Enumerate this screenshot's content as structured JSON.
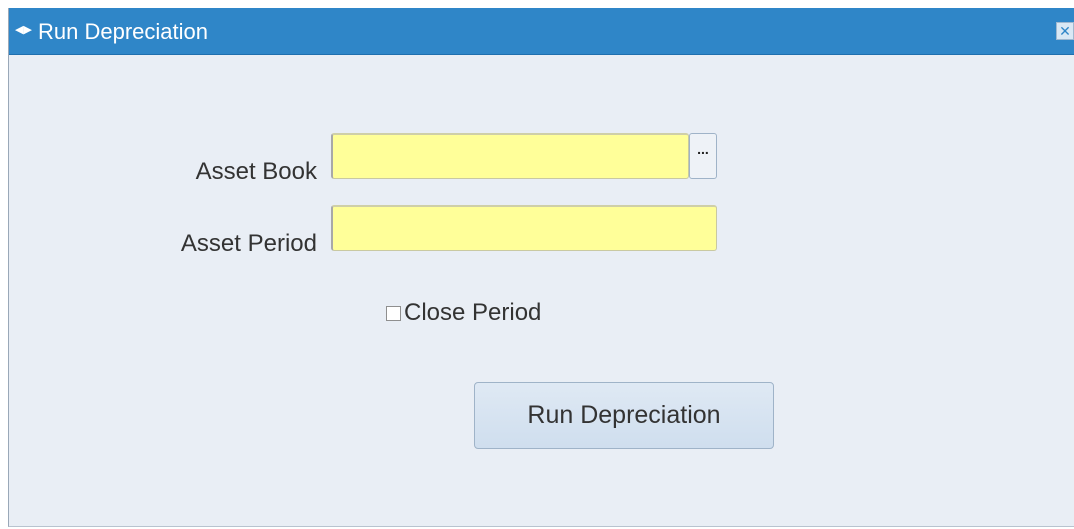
{
  "window": {
    "title": "Run Depreciation",
    "title_icon": "collapse-arrows-icon",
    "close_icon": "close-icon"
  },
  "form": {
    "asset_book": {
      "label": "Asset Book",
      "value": "",
      "lov_button_label": "..."
    },
    "asset_period": {
      "label": "Asset Period",
      "value": ""
    },
    "close_period": {
      "label": "Close Period",
      "checked": false
    },
    "submit_label": "Run Depreciation"
  },
  "colors": {
    "titlebar": "#2f86c8",
    "window_bg": "#e9eef5",
    "required_field": "#ffff99",
    "button_bg": "#d6e3f1"
  }
}
